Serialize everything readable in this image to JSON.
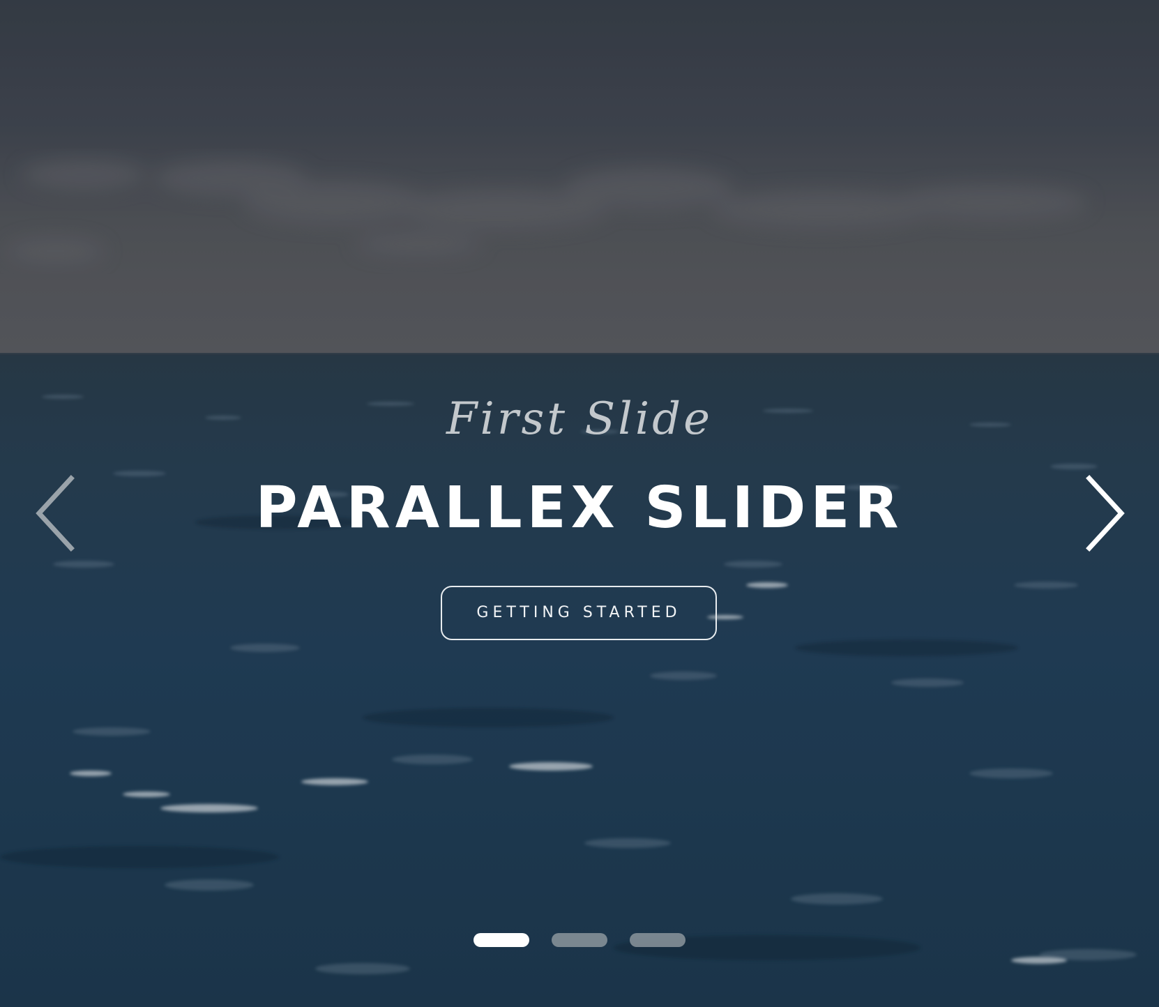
{
  "slider": {
    "subtitle": "First Slide",
    "title": "PARALLEX SLIDER",
    "cta_label": "GETTING STARTED",
    "prev_icon": "chevron-left-icon",
    "next_icon": "chevron-right-icon",
    "active_slide": 1,
    "slide_count": 3,
    "colors": {
      "indicator_active": "#ffffff",
      "indicator_inactive": "#8b959c",
      "arrow_next": "#ffffff",
      "arrow_prev": "#9aa3aa",
      "subtitle": "#c3c8cc",
      "title": "#ffffff"
    }
  }
}
